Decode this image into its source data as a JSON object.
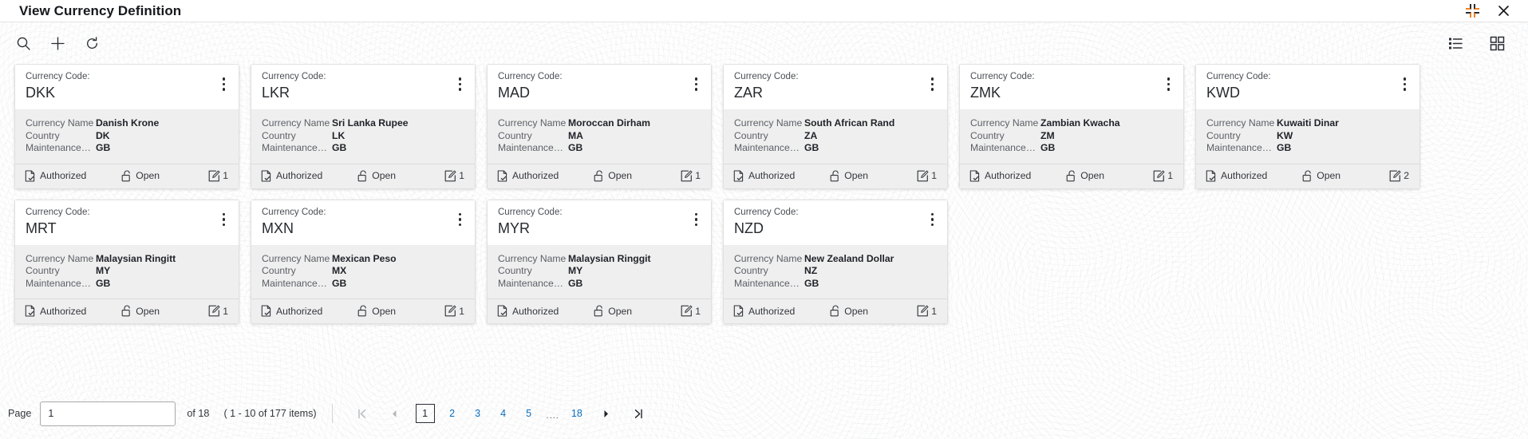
{
  "window": {
    "title": "View Currency Definition",
    "collapse_icon": "collapse-corners-icon",
    "close_icon": "close-icon"
  },
  "toolbar": {
    "left": [
      {
        "name": "search-icon",
        "label": "Search"
      },
      {
        "name": "add-icon",
        "label": "Add"
      },
      {
        "name": "refresh-icon",
        "label": "Refresh"
      }
    ],
    "right": [
      {
        "name": "list-view-icon",
        "label": "List View"
      },
      {
        "name": "grid-view-icon",
        "label": "Grid View"
      }
    ]
  },
  "card_labels": {
    "code_label": "Currency Code:",
    "currency_name": "Currency Name",
    "country": "Country",
    "maintenance": "Maintenance…"
  },
  "cards": [
    {
      "code": "DKK",
      "currency_name": "Danish Krone",
      "country": "DK",
      "maintenance": "GB",
      "status": "Authorized",
      "lock": "Open",
      "count": "1"
    },
    {
      "code": "LKR",
      "currency_name": "Sri Lanka Rupee",
      "country": "LK",
      "maintenance": "GB",
      "status": "Authorized",
      "lock": "Open",
      "count": "1"
    },
    {
      "code": "MAD",
      "currency_name": "Moroccan Dirham",
      "country": "MA",
      "maintenance": "GB",
      "status": "Authorized",
      "lock": "Open",
      "count": "1"
    },
    {
      "code": "ZAR",
      "currency_name": "South African Rand",
      "country": "ZA",
      "maintenance": "GB",
      "status": "Authorized",
      "lock": "Open",
      "count": "1"
    },
    {
      "code": "ZMK",
      "currency_name": "Zambian Kwacha",
      "country": "ZM",
      "maintenance": "GB",
      "status": "Authorized",
      "lock": "Open",
      "count": "1"
    },
    {
      "code": "KWD",
      "currency_name": "Kuwaiti Dinar",
      "country": "KW",
      "maintenance": "GB",
      "status": "Authorized",
      "lock": "Open",
      "count": "2"
    },
    {
      "code": "MRT",
      "currency_name": "Malaysian Ringitt",
      "country": "MY",
      "maintenance": "GB",
      "status": "Authorized",
      "lock": "Open",
      "count": "1"
    },
    {
      "code": "MXN",
      "currency_name": "Mexican Peso",
      "country": "MX",
      "maintenance": "GB",
      "status": "Authorized",
      "lock": "Open",
      "count": "1"
    },
    {
      "code": "MYR",
      "currency_name": "Malaysian Ringgit",
      "country": "MY",
      "maintenance": "GB",
      "status": "Authorized",
      "lock": "Open",
      "count": "1"
    },
    {
      "code": "NZD",
      "currency_name": "New Zealand Dollar",
      "country": "NZ",
      "maintenance": "GB",
      "status": "Authorized",
      "lock": "Open",
      "count": "1"
    }
  ],
  "pagination": {
    "page_label": "Page",
    "page_value": "1",
    "total_pages_text": "of 18",
    "range_text": "( 1 - 10 of 177 items)",
    "first_icon": "first-page-icon",
    "prev_icon": "previous-page-icon",
    "next_icon": "next-page-icon",
    "last_icon": "last-page-icon",
    "ellipsis": "....",
    "pages": [
      {
        "label": "1",
        "active": true
      },
      {
        "label": "2",
        "active": false
      },
      {
        "label": "3",
        "active": false
      },
      {
        "label": "4",
        "active": false
      },
      {
        "label": "5",
        "active": false
      },
      {
        "label": "18",
        "active": false
      }
    ]
  },
  "colors": {
    "link": "#0a6ebd",
    "accent_orange": "#f08321",
    "card_body_bg": "#efefef",
    "text_dark": "#26292f"
  }
}
